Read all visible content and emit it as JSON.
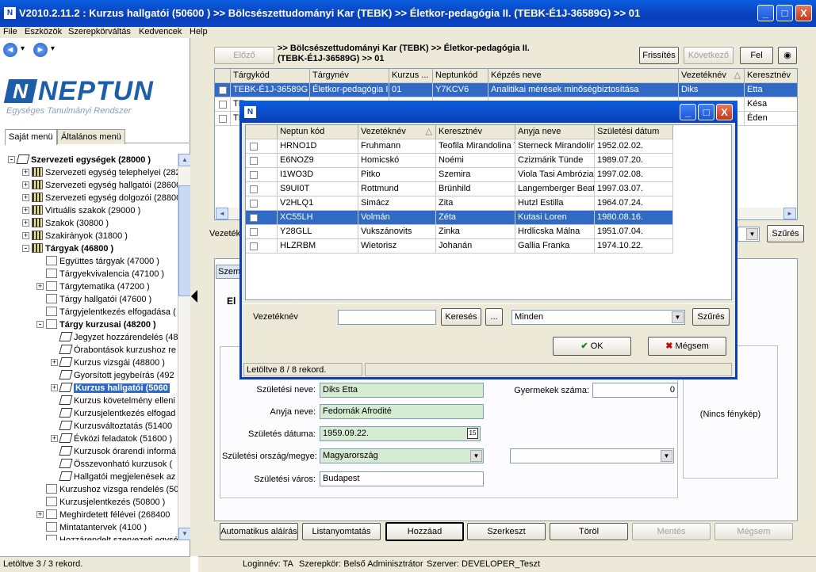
{
  "window": {
    "title": "V2010.2.11.2 : Kurzus hallgatói (50600  )  >> Bölcsészettudományi Kar (TEBK) >> Életkor-pedagógia II. (TEBK-É1J-36589G) >> 01",
    "min": "_",
    "max": "□",
    "close": "X"
  },
  "menu": [
    "File",
    "Eszközök",
    "Szerepkörváltás",
    "Kedvencek",
    "Help"
  ],
  "nav": {
    "back": "◄",
    "forward": "►",
    "dd": "▾"
  },
  "logo": {
    "name": "NEPTUN",
    "sub": "Egységes Tanulmányi Rendszer",
    "mark": "N"
  },
  "left_tabs": [
    "Saját menü",
    "Általános menü"
  ],
  "tree": [
    {
      "label": "Szervezeti egységek (28000  )",
      "indent": 0,
      "icon": "book",
      "bold": true,
      "exp": "-"
    },
    {
      "label": "Szervezeti egység telephelyei (282",
      "indent": 1,
      "icon": "grid",
      "exp": "+"
    },
    {
      "label": "Szervezeti egység hallgatói (28600",
      "indent": 1,
      "icon": "grid",
      "exp": "+"
    },
    {
      "label": "Szervezeti egység dolgozói (28800",
      "indent": 1,
      "icon": "grid",
      "exp": "+"
    },
    {
      "label": "Virtuális szakok (29000  )",
      "indent": 1,
      "icon": "grid",
      "exp": "+"
    },
    {
      "label": "Szakok (30800  )",
      "indent": 1,
      "icon": "grid",
      "exp": "+"
    },
    {
      "label": "Szakirányok (31800  )",
      "indent": 1,
      "icon": "grid",
      "exp": "+"
    },
    {
      "label": "Tárgyak (46800  )",
      "indent": 1,
      "icon": "grid",
      "bold": true,
      "exp": "-"
    },
    {
      "label": "Együttes tárgyak (47000  )",
      "indent": 2,
      "icon": "doc"
    },
    {
      "label": "Tárgyekvivalencia (47100  )",
      "indent": 2,
      "icon": "doc"
    },
    {
      "label": "Tárgytematika (47200  )",
      "indent": 2,
      "icon": "doc",
      "exp": "+"
    },
    {
      "label": "Tárgy hallgatói (47600  )",
      "indent": 2,
      "icon": "doc"
    },
    {
      "label": "Tárgyjelentkezés elfogadása (",
      "indent": 2,
      "icon": "doc"
    },
    {
      "label": "Tárgy kurzusai (48200  )",
      "indent": 2,
      "icon": "doc",
      "bold": true,
      "exp": "-"
    },
    {
      "label": "Jegyzet hozzárendelés (48",
      "indent": 3,
      "icon": "book"
    },
    {
      "label": "Órabontások kurzushoz re",
      "indent": 3,
      "icon": "book"
    },
    {
      "label": "Kurzus vizsgái (48800  )",
      "indent": 3,
      "icon": "book",
      "exp": "+"
    },
    {
      "label": "Gyorsított jegybeírás (492",
      "indent": 3,
      "icon": "book"
    },
    {
      "label": "Kurzus hallgatói (5060",
      "indent": 3,
      "icon": "book",
      "sel": true,
      "exp": "+"
    },
    {
      "label": "Kurzus követelmény elleni",
      "indent": 3,
      "icon": "book"
    },
    {
      "label": "Kurzusjelentkezés elfogad",
      "indent": 3,
      "icon": "book"
    },
    {
      "label": "Kurzusváltoztatás (51400",
      "indent": 3,
      "icon": "book"
    },
    {
      "label": "Évközi feladatok (51600  )",
      "indent": 3,
      "icon": "book",
      "exp": "+"
    },
    {
      "label": "Kurzusok órarendi informá",
      "indent": 3,
      "icon": "book"
    },
    {
      "label": "Összevonható kurzusok (",
      "indent": 3,
      "icon": "book"
    },
    {
      "label": "Hallgatói megjelenések az",
      "indent": 3,
      "icon": "book"
    },
    {
      "label": "Kurzushoz vizsga rendelés (50",
      "indent": 2,
      "icon": "doc"
    },
    {
      "label": "Kurzusjelentkezés (50800  )",
      "indent": 2,
      "icon": "doc"
    },
    {
      "label": "Meghirdetett félévei (268400",
      "indent": 2,
      "icon": "doc",
      "exp": "+"
    },
    {
      "label": "Mintatantervek (4100  )",
      "indent": 2,
      "icon": "doc"
    },
    {
      "label": "Hozzárendelt szervezeti egysé",
      "indent": 2,
      "icon": "doc"
    }
  ],
  "left_status": "Letöltve 3 / 3 rekord.",
  "toolbar": {
    "prev": "Előző",
    "refresh": "Frissítés",
    "next": "Következő",
    "up": "Fel",
    "breadcrumb_line1": ">> Bölcsészettudományi Kar (TEBK) >> Életkor-pedagógia II.",
    "breadcrumb_line2": "(TEBK-É1J-36589G) >> 01"
  },
  "main_grid": {
    "headers": [
      "Tárgykód",
      "Tárgynév",
      "Kurzus ...",
      "Neptunkód",
      "Képzés neve",
      "Vezetéknév",
      "Keresztnév"
    ],
    "sort_mark": "△",
    "rows": [
      [
        "TEBK-É1J-36589G",
        "Életkor-pedagógia II.",
        "01",
        "Y7KCV6",
        "Analitikai mérések minőségbiztosítása",
        "Diks",
        "Etta"
      ],
      [
        "TE",
        "",
        "",
        "",
        "",
        "",
        "Késa"
      ],
      [
        "TE",
        "",
        "",
        "",
        "",
        "",
        "Éden"
      ]
    ]
  },
  "filter": {
    "label": "Vezetékn",
    "button": "Szűrés"
  },
  "detail_tab": "Szem",
  "detail_heading": "El",
  "form": {
    "birth_name_label": "Születési neve:",
    "birth_name": "Diks Etta",
    "mother_label": "Anyja neve:",
    "mother": "Fedornák Afrodité",
    "birth_date_label": "Születés dátuma:",
    "birth_date": "1959.09.22.",
    "cal": "15",
    "country_label": "Születési ország/megye:",
    "country": "Magyarország",
    "city_label": "Születési város:",
    "city": "Budapest",
    "children_label": "Gyermekek száma:",
    "children": "0",
    "photo": "(Nincs fénykép)"
  },
  "bottom_buttons": [
    "Automatikus aláírás",
    "Listanyomtatás",
    "Hozzáad",
    "Szerkeszt",
    "Töröl",
    "Mentés",
    "Mégsem"
  ],
  "status": {
    "login": "Loginnév: TA",
    "role": "Szerepkör: Belső Adminisztrátor",
    "server": "Szerver: DEVELOPER_Teszt"
  },
  "dialog": {
    "headers": [
      "Neptun kód",
      "Vezetéknév",
      "Keresztnév",
      "Anyja neve",
      "Születési dátum"
    ],
    "sort_mark": "△",
    "rows": [
      [
        "HRNO1D",
        "Fruhmann",
        "Teofila Mirandolina T",
        "Sterneck Mirandolín",
        "1952.02.02."
      ],
      [
        "E6NOZ9",
        "Homicskó",
        "Noémi",
        "Czizmárik Tünde",
        "1989.07.20."
      ],
      [
        "I1WO3D",
        "Pitko",
        "Szemira",
        "Viola Tasi Ambrózia",
        "1997.02.08."
      ],
      [
        "S9UI0T",
        "Rottmund",
        "Brünhild",
        "Langemberger Beatr",
        "1997.03.07."
      ],
      [
        "V2HLQ1",
        "Simácz",
        "Zita",
        "Hutzl Estilla",
        "1964.07.24."
      ],
      [
        "XC55LH",
        "Volmán",
        "Zéta",
        "Kutasi Loren",
        "1980.08.16."
      ],
      [
        "Y28GLL",
        "Vukszánovits",
        "Zinka",
        "Hrdlicska Málna",
        "1951.07.04."
      ],
      [
        "HLZRBM",
        "Wietorisz",
        "Johanán",
        "Gallia Franka",
        "1974.10.22."
      ]
    ],
    "selected_row": 5,
    "search_label": "Vezetéknév",
    "search_value": "",
    "search_btn": "Keresés",
    "dots": "...",
    "filter_value": "Minden",
    "filter_btn": "Szűrés",
    "ok": "OK",
    "ok_icon": "✔",
    "cancel": "Mégsem",
    "cancel_icon": "✖",
    "status": "Letöltve 8 / 8 rekord."
  }
}
